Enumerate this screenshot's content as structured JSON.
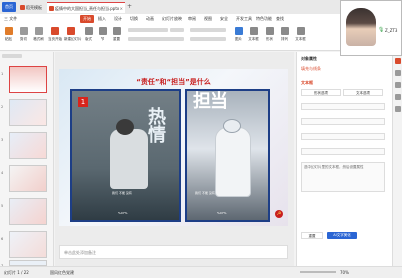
{
  "titlebar": {
    "home": "首页",
    "tabs": [
      {
        "label": "稻壳模板",
        "icon_color": "#d94a2c"
      },
      {
        "label": "疫情中的大国担当_责任与担当.pptx",
        "icon_color": "#d94a2c"
      }
    ],
    "new_tab": "+"
  },
  "menubar": {
    "items": [
      "三 文件",
      "开始",
      "插入",
      "设计",
      "切换",
      "动画",
      "幻灯片放映",
      "审阅",
      "视图",
      "安全",
      "开发工具",
      "特色功能",
      "查找"
    ],
    "active": "开始"
  },
  "ribbon": {
    "buttons": [
      {
        "label": "粘贴",
        "icon": "paste-icon",
        "color": "#e07c2a"
      },
      {
        "label": "剪切",
        "icon": "scissors-icon",
        "color": "#777"
      },
      {
        "label": "格式刷",
        "icon": "format-brush-icon",
        "color": "#777"
      },
      {
        "label": "当页开始",
        "icon": "play-icon",
        "color": "#d94a2c"
      },
      {
        "label": "新建幻灯片",
        "icon": "new-slide-icon",
        "color": "#d94a2c"
      },
      {
        "label": "版式",
        "icon": "layout-icon",
        "color": "#555"
      },
      {
        "label": "节",
        "icon": "section-icon",
        "color": "#555"
      },
      {
        "label": "重置",
        "icon": "reset-icon",
        "color": "#555"
      },
      {
        "label": "图片",
        "icon": "image-icon",
        "color": "#3a7bd5"
      },
      {
        "label": "文本框",
        "icon": "textbox-icon",
        "color": "#555"
      },
      {
        "label": "形状",
        "icon": "shape-icon",
        "color": "#555"
      },
      {
        "label": "排列",
        "icon": "arrange-icon",
        "color": "#555"
      },
      {
        "label": "文本框",
        "icon": "textbox-icon",
        "color": "#555"
      }
    ]
  },
  "thumbnails": [
    {
      "num": "1",
      "selected": true
    },
    {
      "num": "2",
      "selected": false
    },
    {
      "num": "3",
      "selected": false
    },
    {
      "num": "4",
      "selected": false
    },
    {
      "num": "5",
      "selected": false
    },
    {
      "num": "6",
      "selected": false
    },
    {
      "num": "7",
      "selected": false
    }
  ],
  "slide": {
    "title": "“责任”和“担当”是什么",
    "card1": {
      "number": "1",
      "big_text": "热情",
      "caption": "我们 不能 没有",
      "footer": "%07%"
    },
    "card2": {
      "big_text": "担当",
      "caption": "我们 不能 没有",
      "footer": "%07%"
    }
  },
  "notes": {
    "placeholder": "单击此处添加备注"
  },
  "right_panel": {
    "title": "对象属性",
    "tab": "填充与线条",
    "section": "文本框",
    "buttons": [
      "形状选项",
      "文本选项"
    ],
    "fields": [
      "",
      "",
      "",
      "",
      ""
    ],
    "desc": "选中幻灯片里的文本框，然后设置属性",
    "ai_button": "AI文字美化",
    "reset": "重置"
  },
  "video": {
    "name": "Z_ZT3"
  },
  "statusbar": {
    "slide_info": "幻灯片 1 / 22",
    "theme": "国风红色党建",
    "zoom": "70%"
  }
}
